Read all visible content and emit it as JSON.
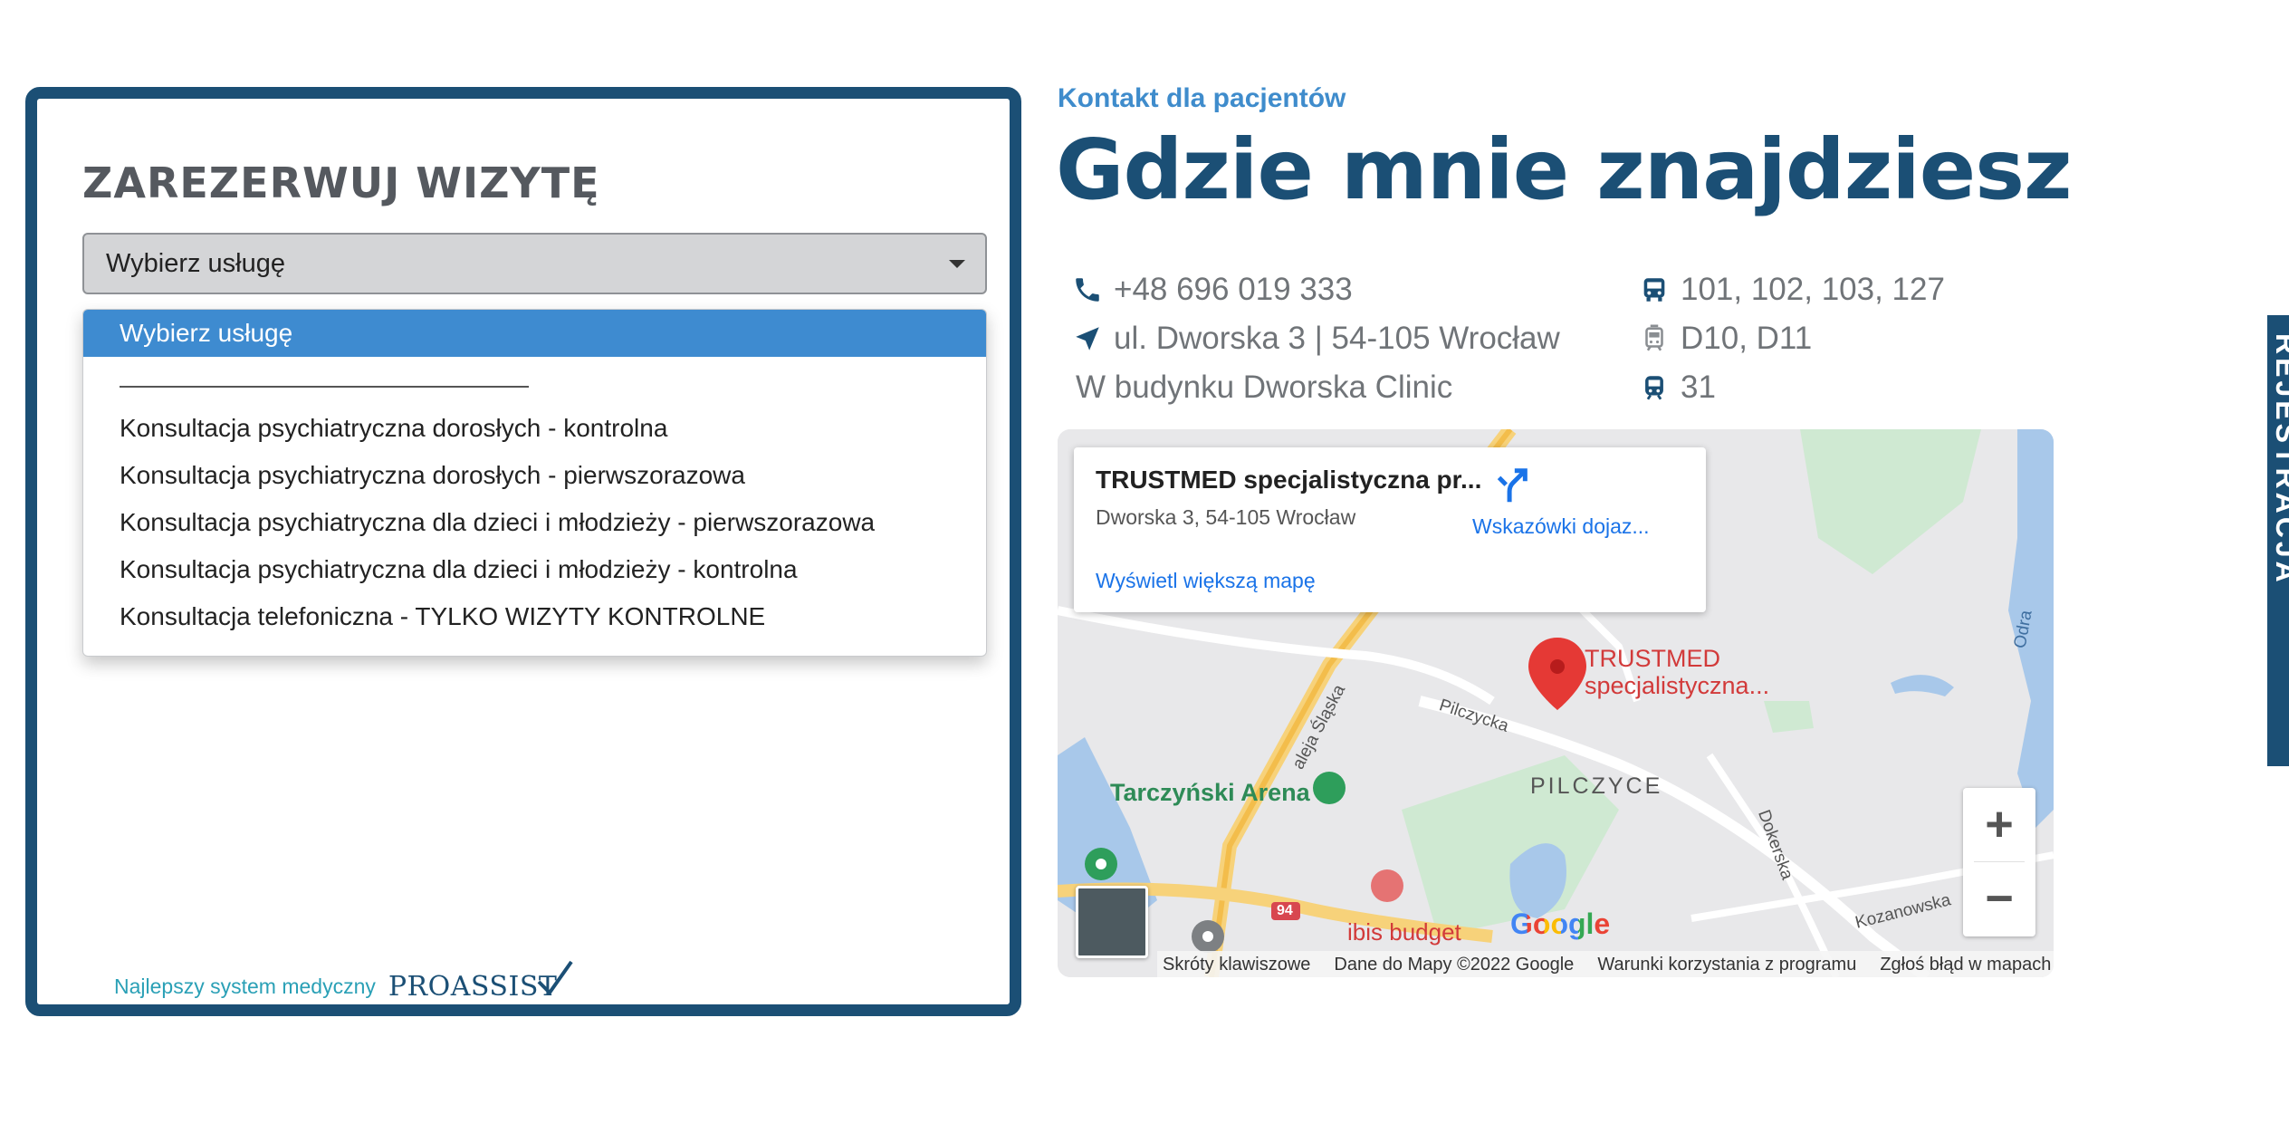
{
  "booking": {
    "title": "ZAREZERWUJ WIZYTĘ",
    "select_value": "Wybierz usługę",
    "options": [
      "Wybierz usługę",
      "Konsultacja psychiatryczna dorosłych - kontrolna",
      "Konsultacja psychiatryczna dorosłych - pierwszorazowa",
      "Konsultacja psychiatryczna dla dzieci i młodzieży - pierwszorazowa",
      "Konsultacja psychiatryczna dla dzieci i młodzieży - kontrolna",
      "Konsultacja telefoniczna - TYLKO WIZYTY KONTROLNE"
    ],
    "footer_tagline": "Najlepszy system medyczny",
    "footer_logo": "PROASSIST"
  },
  "contact": {
    "kicker": "Kontakt dla pacjentów",
    "headline": "Gdzie mnie znajdziesz",
    "phone": "+48 696 019 333",
    "address": "ul. Dworska 3 | 54-105 Wrocław",
    "building": "W budynku Dworska Clinic",
    "bus_lines": "101, 102, 103, 127",
    "tram_lines": "D10, D11",
    "other_lines": "31"
  },
  "map": {
    "place_name": "TRUSTMED specjalistyczna pr...",
    "place_address": "Dworska 3, 54-105 Wrocław",
    "directions_label": "Wskazówki dojaz...",
    "larger_map_label": "Wyświetl większą mapę",
    "marker_label_line1": "TRUSTMED",
    "marker_label_line2": "specjalistyczna...",
    "labels": {
      "arena": "Tarczyński Arena",
      "district": "PILCZYCE",
      "street_pilczycka": "Pilczycka",
      "street_slaska": "aleja Śląska",
      "street_dokerska": "Dokerska",
      "street_kozanowska": "Kozanowska",
      "river": "Odra",
      "hotel": "ibis budget",
      "road_number": "94"
    },
    "zoom_in": "+",
    "zoom_out": "−",
    "google": "Google",
    "attribution": {
      "shortcuts": "Skróty klawiszowe",
      "data": "Dane do Mapy ©2022 Google",
      "terms": "Warunki korzystania z programu",
      "report": "Zgłoś błąd w mapach"
    }
  },
  "side_tab": {
    "label": "REJESTRACJA"
  },
  "colors": {
    "brand_dark": "#1b4f75",
    "accent_blue": "#3e8bd0",
    "map_red": "#e53935"
  }
}
